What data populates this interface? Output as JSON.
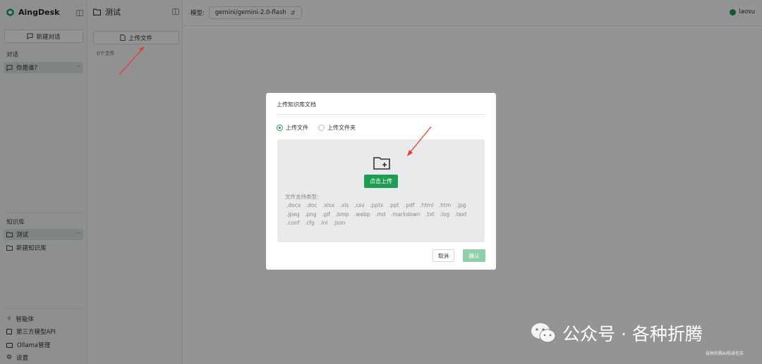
{
  "app": {
    "name": "AingDesk"
  },
  "sidebar": {
    "new_chat_label": "新建对话",
    "chats_label": "对话",
    "chats": [
      {
        "label": "你是谁?"
      }
    ],
    "kb_label": "知识库",
    "kb_items": [
      {
        "label": "测试"
      },
      {
        "label": "新建知识库"
      }
    ],
    "bottom": [
      {
        "label": "智能体",
        "icon": "agent-icon"
      },
      {
        "label": "第三方模型API",
        "icon": "api-icon"
      },
      {
        "label": "Ollama管理",
        "icon": "monitor-icon"
      },
      {
        "label": "设置",
        "icon": "gear-icon"
      }
    ]
  },
  "panel": {
    "title": "测试",
    "upload_label": "上传文件",
    "file_count": "0个文件"
  },
  "main": {
    "model_label": "模型:",
    "model_value": "gemini/gemini-2.0-flash",
    "user": "laosu"
  },
  "modal": {
    "title": "上传知识库文档",
    "options": [
      {
        "label": "上传文件",
        "selected": true
      },
      {
        "label": "上传文件夹",
        "selected": false
      }
    ],
    "upload_button": "点击上传",
    "types_title": "文件支持类型:",
    "types": [
      ".docx",
      ".doc",
      ".xlsx",
      ".xls",
      ".csv",
      ".pptx",
      ".ppt",
      ".pdf",
      ".html",
      ".htm",
      ".jpg",
      ".jpeg",
      ".png",
      ".gif",
      ".bmp",
      ".webp",
      ".md",
      ".markdown",
      ".txt",
      ".log",
      ".text",
      ".conf",
      ".cfg",
      ".ini",
      ".json"
    ],
    "cancel": "取消",
    "confirm": "确认"
  },
  "watermark": {
    "text": "公众号 · 各种折腾",
    "sub": "各种折腾AI杨涛老苏"
  },
  "colors": {
    "accent": "#1f9d55",
    "accent_disabled": "#8fd0a8"
  }
}
